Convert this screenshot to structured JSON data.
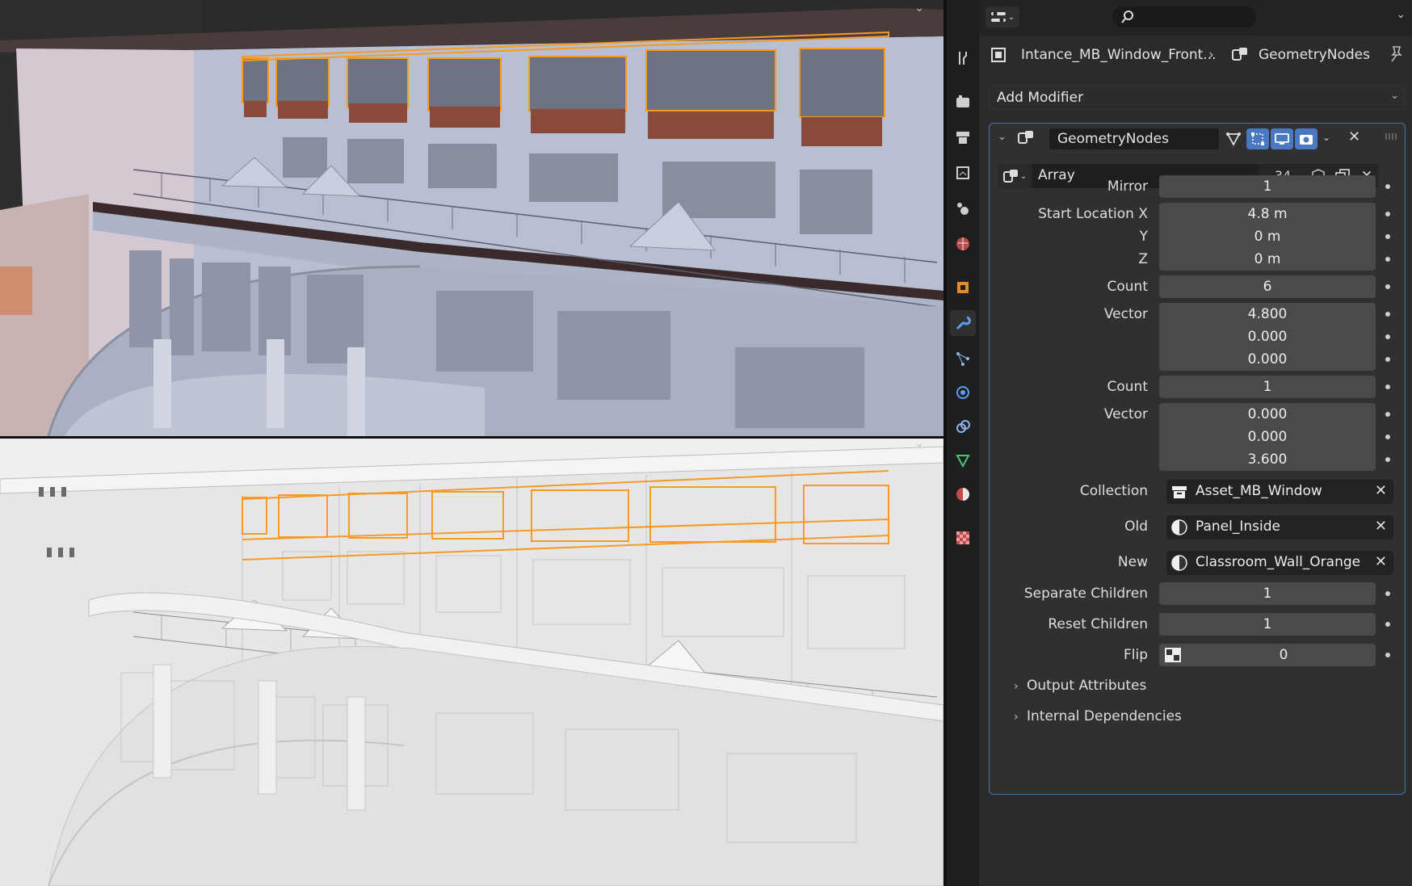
{
  "properties": {
    "breadcrumb": {
      "object": "Intance_MB_Window_Front...",
      "modifier": "GeometryNodes"
    },
    "add_modifier_label": "Add Modifier",
    "modifier": {
      "name": "GeometryNodes",
      "node_group": {
        "name": "Array",
        "users": "34"
      },
      "params": {
        "mirror": {
          "label": "Mirror",
          "value": "1"
        },
        "start_location": {
          "label_x": "Start Location X",
          "label_y": "Y",
          "label_z": "Z",
          "x": "4.8 m",
          "y": "0 m",
          "z": "0 m"
        },
        "count1": {
          "label": "Count",
          "value": "6"
        },
        "vector1": {
          "label": "Vector",
          "x": "4.800",
          "y": "0.000",
          "z": "0.000"
        },
        "count2": {
          "label": "Count",
          "value": "1"
        },
        "vector2": {
          "label": "Vector",
          "x": "0.000",
          "y": "0.000",
          "z": "3.600"
        },
        "collection": {
          "label": "Collection",
          "value": "Asset_MB_Window"
        },
        "old_material": {
          "label": "Old",
          "value": "Panel_Inside"
        },
        "new_material": {
          "label": "New",
          "value": "Classroom_Wall_Orange"
        },
        "separate_children": {
          "label": "Separate Children",
          "value": "1"
        },
        "reset_children": {
          "label": "Reset Children",
          "value": "1"
        },
        "flip": {
          "label": "Flip",
          "value": "0"
        }
      },
      "subpanels": {
        "output_attributes": "Output Attributes",
        "internal_dependencies": "Internal Dependencies"
      }
    }
  },
  "tabs": [
    "tool-icon",
    "render-icon",
    "output-icon",
    "view-layer-icon",
    "scene-icon",
    "world-icon",
    "object-icon",
    "modifier-icon",
    "particles-icon",
    "physics-icon",
    "constraints-icon",
    "data-icon",
    "material-icon",
    "texture-icon"
  ],
  "colors": {
    "accent": "#4772b3",
    "selection": "#f59a23",
    "active_tab_icon": "#5a9df5"
  }
}
